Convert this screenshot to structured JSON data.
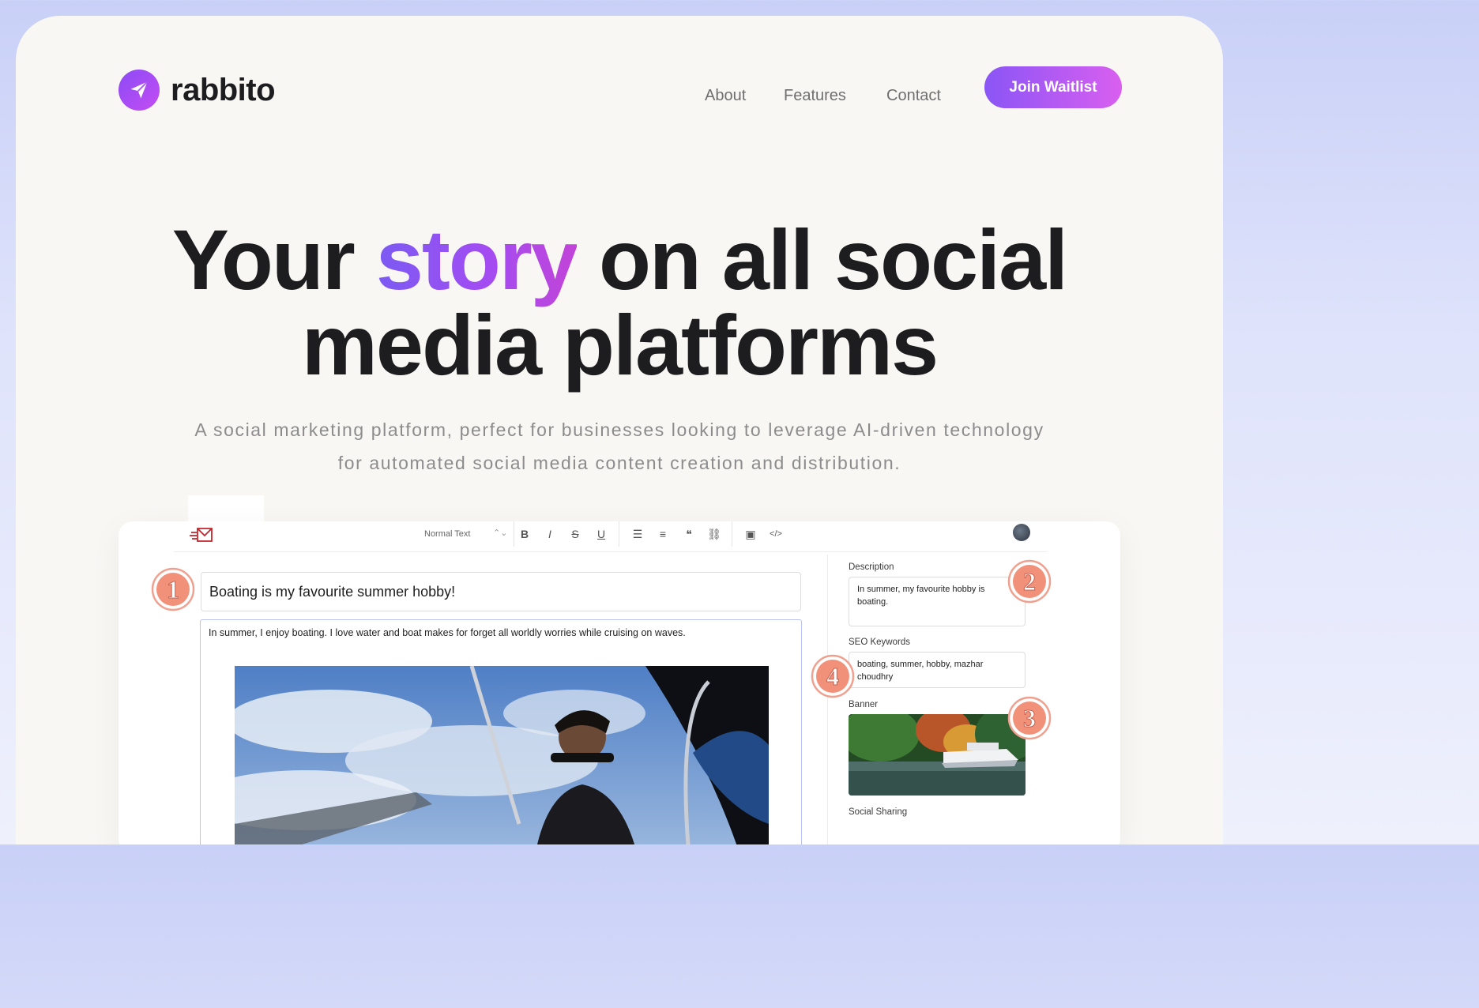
{
  "brand": {
    "name": "rabbito",
    "logo_icon": "paper-plane-icon"
  },
  "nav": {
    "items": [
      "About",
      "Features",
      "Contact"
    ],
    "cta": "Join Waitlist"
  },
  "hero": {
    "title_part1": "Your ",
    "title_accent": "story",
    "title_part2": " on all social",
    "title_line2": "media platforms",
    "subtitle_line1": "A social marketing platform, perfect for businesses looking to leverage AI-driven technology",
    "subtitle_line2": "for automated social media content creation and distribution."
  },
  "editor": {
    "text_style": "Normal Text",
    "toolbar_icons": [
      "bold-icon",
      "italic-icon",
      "strikethrough-icon",
      "underline-icon",
      "bullet-list-icon",
      "numbered-list-icon",
      "quote-icon",
      "link-icon",
      "image-icon",
      "code-icon"
    ],
    "toolbar_glyphs": [
      "B",
      "I",
      "S",
      "U",
      "☰",
      "≡",
      "❝",
      "⛓",
      "▣",
      "</>"
    ],
    "post_title": "Boating is my favourite summer hobby!",
    "post_body": "In summer, I enjoy boating. I love water and boat makes for forget all worldly worries while cruising on waves.",
    "sidebar": {
      "description_label": "Description",
      "description_value": "In summer, my favourite hobby is boating.",
      "seo_label": "SEO Keywords",
      "seo_value": "boating, summer, hobby, mazhar choudhry",
      "banner_label": "Banner",
      "social_label": "Social Sharing"
    },
    "step_badges": [
      "1",
      "2",
      "3",
      "4"
    ]
  },
  "colors": {
    "accent_start": "#8a55f5",
    "accent_end": "#d95ff0",
    "badge_fill": "#f2917a",
    "text_dark": "#1d1d1f",
    "text_muted": "#8c8c8c"
  }
}
